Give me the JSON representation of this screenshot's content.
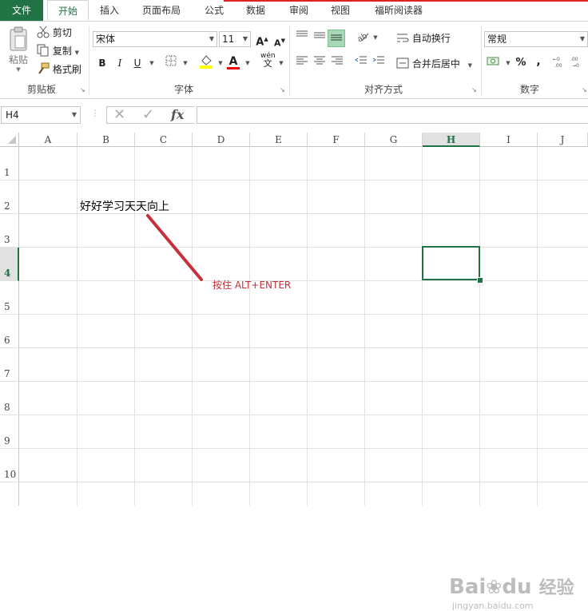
{
  "tabs": [
    {
      "label": "文件"
    },
    {
      "label": "开始"
    },
    {
      "label": "插入"
    },
    {
      "label": "页面布局"
    },
    {
      "label": "公式"
    },
    {
      "label": "数据"
    },
    {
      "label": "审阅"
    },
    {
      "label": "视图"
    },
    {
      "label": "福昕阅读器"
    }
  ],
  "ribbon": {
    "clipboard": {
      "paste": "粘贴",
      "cut": "剪切",
      "copy": "复制",
      "format_painter": "格式刷",
      "label": "剪贴板"
    },
    "font": {
      "name": "宋体",
      "size": "11",
      "bold": "B",
      "italic": "I",
      "underline": "U",
      "grow": "A",
      "shrink": "A",
      "font_color": "A",
      "phonetic": "wén",
      "phonetic2": "文",
      "label": "字体"
    },
    "alignment": {
      "wrap_text": "自动换行",
      "merge_center": "合并后居中",
      "label": "对齐方式"
    },
    "number": {
      "format": "常规",
      "percent": "%",
      "comma": ",",
      "label": "数字"
    }
  },
  "formula_bar": {
    "name_box": "H4",
    "fx": "fx",
    "value": ""
  },
  "columns": [
    "A",
    "B",
    "C",
    "D",
    "E",
    "F",
    "G",
    "H",
    "I",
    "J"
  ],
  "rows": [
    "1",
    "2",
    "3",
    "4",
    "5",
    "6",
    "7",
    "8",
    "9",
    "10"
  ],
  "selected_cell": "H4",
  "cells": {
    "B2": "好好学习天天向上"
  },
  "annotation": "按住 ALT+ENTER",
  "watermark": {
    "brand": "Bai",
    "brand2": "du",
    "cn": "经验",
    "url": "jingyan.baidu.com"
  },
  "colors": {
    "excel_green": "#217346",
    "annotation_red": "#c5303a",
    "grid": "#e1e1e1"
  }
}
